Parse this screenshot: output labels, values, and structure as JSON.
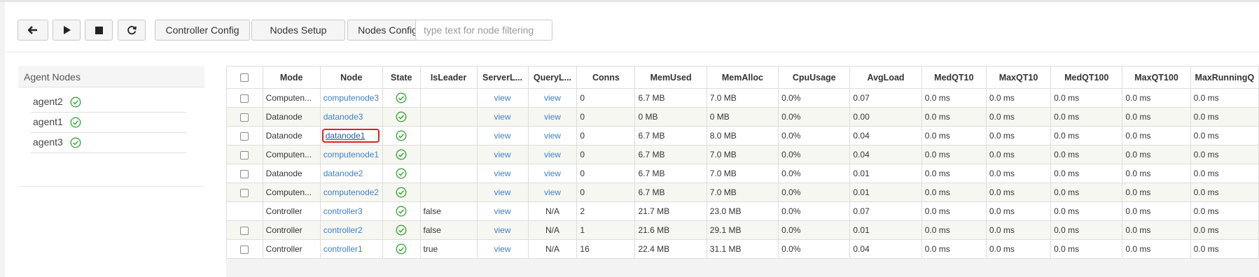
{
  "toolbar": {
    "icons": [
      "arrow-left-icon",
      "play-icon",
      "stop-icon",
      "refresh-icon"
    ],
    "controller_config": "Controller Config",
    "nodes_setup": "Nodes Setup",
    "nodes_config": "Nodes Config",
    "filter_placeholder": "type text for node filtering",
    "filter_value": ""
  },
  "agent_nodes": {
    "title": "Agent Nodes",
    "items": [
      {
        "name": "agent2",
        "status_icon": "check-circle-icon"
      },
      {
        "name": "agent1",
        "status_icon": "check-circle-icon"
      },
      {
        "name": "agent3",
        "status_icon": "check-circle-icon"
      }
    ]
  },
  "nodes_table": {
    "columns": [
      "Mode",
      "Node",
      "State",
      "IsLeader",
      "ServerL...",
      "QueryL...",
      "Conns",
      "MemUsed",
      "MemAlloc",
      "CpuUsage",
      "AvgLoad",
      "MedQT10",
      "MaxQT10",
      "MedQT100",
      "MaxQT100",
      "MaxRunningQ"
    ],
    "rows": [
      {
        "checkbox": true,
        "mode": "Computen...",
        "node": "computenode3",
        "state": "ok",
        "is_leader": "",
        "server_log": "view",
        "query_log": "view",
        "conns": "0",
        "mem_used": "6.7 MB",
        "mem_alloc": "7.0 MB",
        "cpu": "0.0%",
        "avg_load": "0.07",
        "med_qt10": "0.0 ms",
        "max_qt10": "0.0 ms",
        "med_qt100": "0.0 ms",
        "max_qt100": "0.0 ms",
        "max_running": "0.0 ms"
      },
      {
        "checkbox": true,
        "mode": "Datanode",
        "node": "datanode3",
        "state": "ok",
        "is_leader": "",
        "server_log": "view",
        "query_log": "view",
        "conns": "0",
        "mem_used": "0 MB",
        "mem_alloc": "0 MB",
        "cpu": "0.0%",
        "avg_load": "0.00",
        "med_qt10": "0.0 ms",
        "max_qt10": "0.0 ms",
        "med_qt100": "0.0 ms",
        "max_qt100": "0.0 ms",
        "max_running": "0.0 ms"
      },
      {
        "checkbox": true,
        "mode": "Datanode",
        "node": "datanode1",
        "state": "ok",
        "is_leader": "",
        "server_log": "view",
        "query_log": "view",
        "conns": "0",
        "mem_used": "6.7 MB",
        "mem_alloc": "8.0 MB",
        "cpu": "0.0%",
        "avg_load": "0.04",
        "med_qt10": "0.0 ms",
        "max_qt10": "0.0 ms",
        "med_qt100": "0.0 ms",
        "max_qt100": "0.0 ms",
        "max_running": "0.0 ms"
      },
      {
        "checkbox": true,
        "mode": "Computen...",
        "node": "computenode1",
        "state": "ok",
        "is_leader": "",
        "server_log": "view",
        "query_log": "view",
        "conns": "0",
        "mem_used": "6.7 MB",
        "mem_alloc": "7.0 MB",
        "cpu": "0.0%",
        "avg_load": "0.04",
        "med_qt10": "0.0 ms",
        "max_qt10": "0.0 ms",
        "med_qt100": "0.0 ms",
        "max_qt100": "0.0 ms",
        "max_running": "0.0 ms"
      },
      {
        "checkbox": true,
        "mode": "Datanode",
        "node": "datanode2",
        "state": "ok",
        "is_leader": "",
        "server_log": "view",
        "query_log": "view",
        "conns": "0",
        "mem_used": "6.7 MB",
        "mem_alloc": "7.0 MB",
        "cpu": "0.0%",
        "avg_load": "0.01",
        "med_qt10": "0.0 ms",
        "max_qt10": "0.0 ms",
        "med_qt100": "0.0 ms",
        "max_qt100": "0.0 ms",
        "max_running": "0.0 ms"
      },
      {
        "checkbox": true,
        "mode": "Computen...",
        "node": "computenode2",
        "state": "ok",
        "is_leader": "",
        "server_log": "view",
        "query_log": "view",
        "conns": "0",
        "mem_used": "6.7 MB",
        "mem_alloc": "7.0 MB",
        "cpu": "0.0%",
        "avg_load": "0.01",
        "med_qt10": "0.0 ms",
        "max_qt10": "0.0 ms",
        "med_qt100": "0.0 ms",
        "max_qt100": "0.0 ms",
        "max_running": "0.0 ms"
      },
      {
        "checkbox": false,
        "mode": "Controller",
        "node": "controller3",
        "state": "ok",
        "is_leader": "false",
        "server_log": "view",
        "query_log": "N/A",
        "conns": "2",
        "mem_used": "21.7 MB",
        "mem_alloc": "23.0 MB",
        "cpu": "0.0%",
        "avg_load": "0.07",
        "med_qt10": "0.0 ms",
        "max_qt10": "0.0 ms",
        "med_qt100": "0.0 ms",
        "max_qt100": "0.0 ms",
        "max_running": "0.0 ms"
      },
      {
        "checkbox": true,
        "mode": "Controller",
        "node": "controller2",
        "state": "ok",
        "is_leader": "false",
        "server_log": "view",
        "query_log": "N/A",
        "conns": "1",
        "mem_used": "21.6 MB",
        "mem_alloc": "29.1 MB",
        "cpu": "0.0%",
        "avg_load": "0.01",
        "med_qt10": "0.0 ms",
        "max_qt10": "0.0 ms",
        "med_qt100": "0.0 ms",
        "max_qt100": "0.0 ms",
        "max_running": "0.0 ms"
      },
      {
        "checkbox": true,
        "mode": "Controller",
        "node": "controller1",
        "state": "ok",
        "is_leader": "true",
        "server_log": "view",
        "query_log": "N/A",
        "conns": "16",
        "mem_used": "22.4 MB",
        "mem_alloc": "31.1 MB",
        "cpu": "0.0%",
        "avg_load": "0.04",
        "med_qt10": "0.0 ms",
        "max_qt10": "0.0 ms",
        "med_qt100": "0.0 ms",
        "max_qt100": "0.0 ms",
        "max_running": "0.0 ms"
      }
    ]
  },
  "colors": {
    "link": "#3f80c8",
    "ok": "#3aa83a",
    "highlight": "#e02020"
  }
}
